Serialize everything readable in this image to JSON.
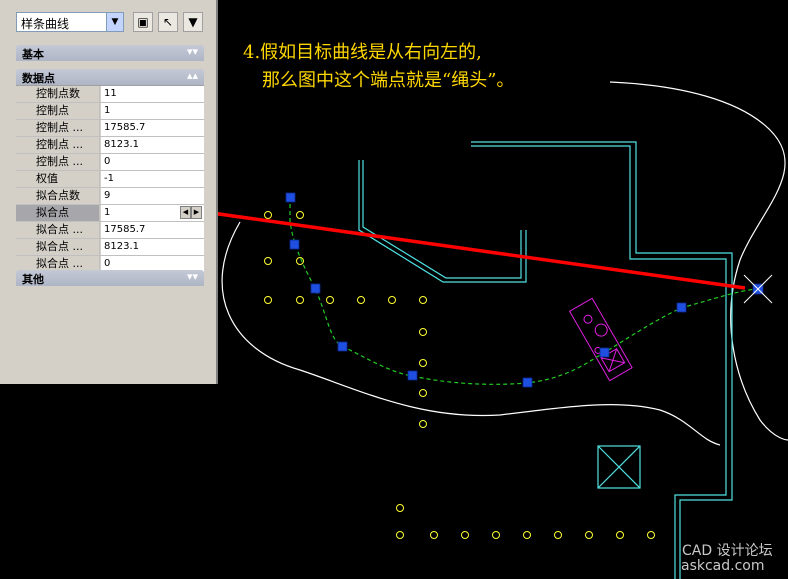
{
  "toolbar": {
    "object_type": "样条曲线",
    "icons": [
      "quick-select-icon",
      "select-objects-icon",
      "filter-icon"
    ]
  },
  "sections": {
    "basic": "基本",
    "data_points": "数据点",
    "other": "其他"
  },
  "properties": [
    {
      "label": "控制点数",
      "value": "11"
    },
    {
      "label": "控制点",
      "value": "1"
    },
    {
      "label": "控制点 ...",
      "value": "17585.7"
    },
    {
      "label": "控制点 ...",
      "value": "8123.1"
    },
    {
      "label": "控制点 ...",
      "value": "0"
    },
    {
      "label": "权值",
      "value": "-1"
    },
    {
      "label": "拟合点数",
      "value": "9"
    },
    {
      "label": "拟合点",
      "value": "1"
    },
    {
      "label": "拟合点 ...",
      "value": "17585.7"
    },
    {
      "label": "拟合点 ...",
      "value": "8123.1"
    },
    {
      "label": "拟合点 ...",
      "value": "0"
    }
  ],
  "annotation": {
    "line1": "4.假如目标曲线是从右向左的,",
    "line2": "那么图中这个端点就是“绳头”。"
  },
  "watermark": {
    "line1": "CAD 设计论坛",
    "line2": "askcad.com"
  },
  "colors": {
    "background": "#000000",
    "wall": "#4fe3e3",
    "boundary": "#ffffff",
    "spline": "#22cc22",
    "grip": "#1f4fe0",
    "markers": "#ffff33",
    "arrow": "#ff0000",
    "block": "#e020e0"
  }
}
